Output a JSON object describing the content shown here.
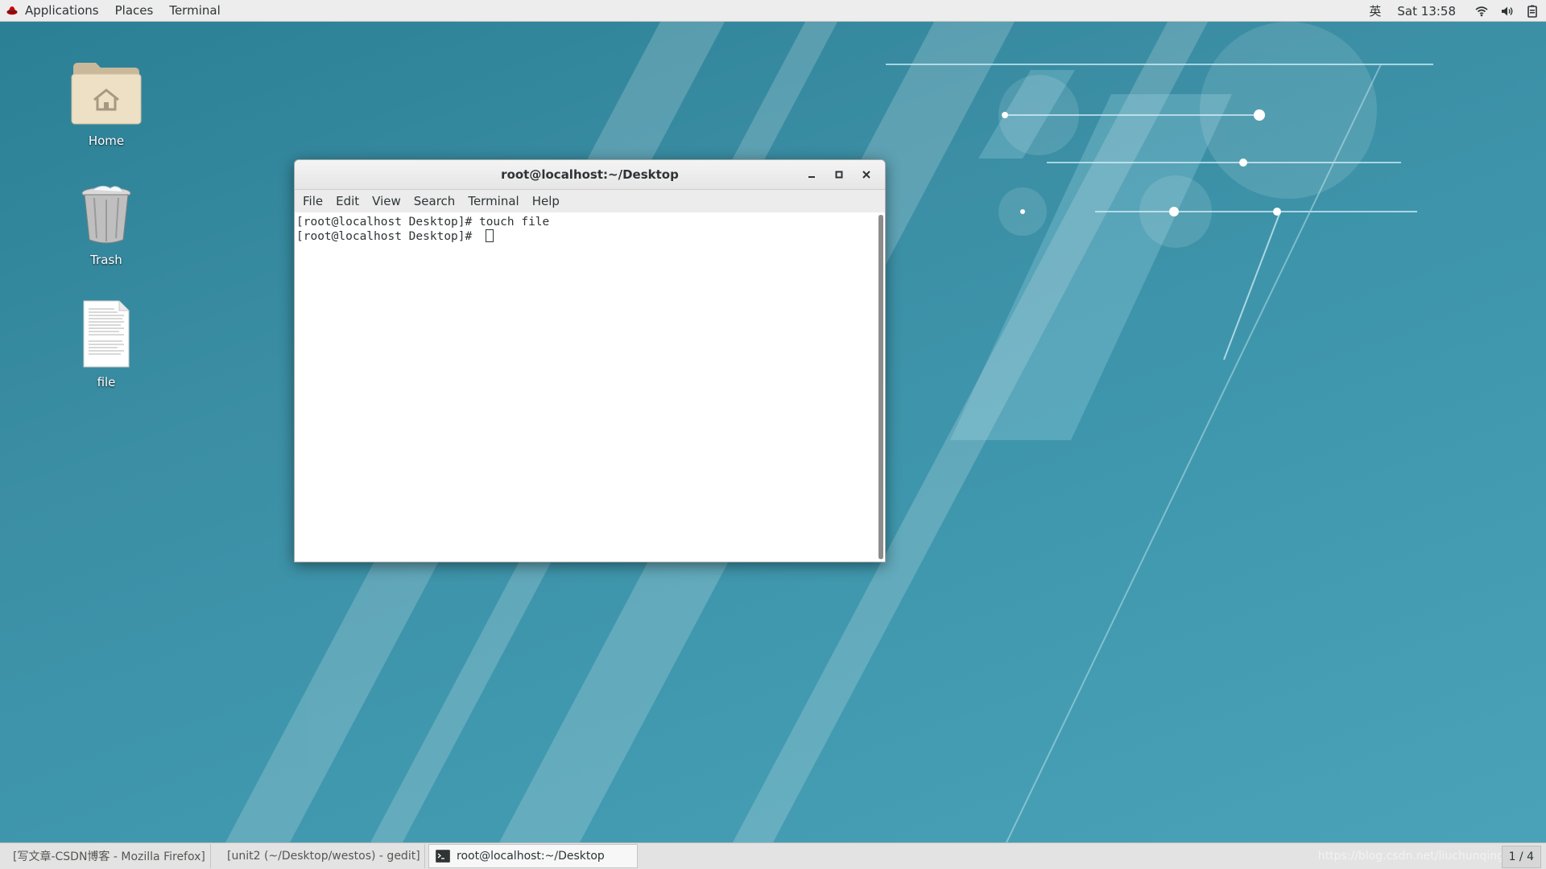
{
  "topbar": {
    "applications": "Applications",
    "places": "Places",
    "terminal": "Terminal",
    "input_method": "英",
    "clock": "Sat 13:58",
    "icons": [
      "fedora-logo-icon",
      "wifi-icon",
      "volume-icon",
      "power-icon"
    ]
  },
  "desktop": {
    "home_label": "Home",
    "trash_label": "Trash",
    "file_label": "file"
  },
  "window": {
    "title": "root@localhost:~/Desktop",
    "menu": [
      "File",
      "Edit",
      "View",
      "Search",
      "Terminal",
      "Help"
    ],
    "lines": [
      "[root@localhost Desktop]# touch file",
      "[root@localhost Desktop]# "
    ]
  },
  "taskbar": {
    "tasks": [
      "[写文章-CSDN博客 - Mozilla Firefox]",
      "[unit2 (~/Desktop/westos) - gedit]",
      "root@localhost:~/Desktop"
    ],
    "workspace": "1 / 4",
    "watermark": "https://blog.csdn.net/liuchunqing"
  }
}
